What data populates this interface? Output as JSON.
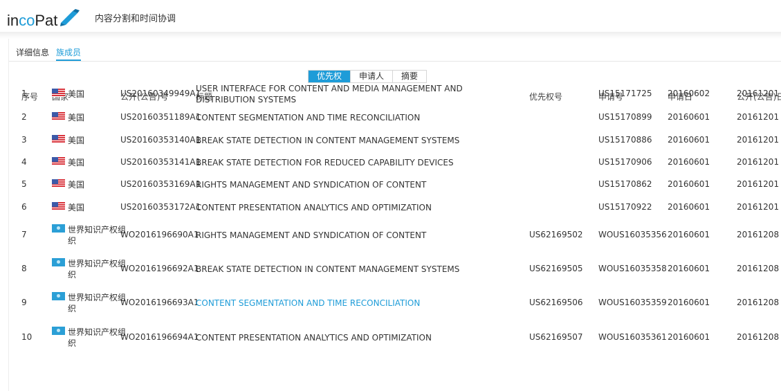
{
  "app": {
    "logo_prefix": "in",
    "logo_mid": "co",
    "logo_suffix": "Pat",
    "page_title": "内容分割和时间协调"
  },
  "tabs": [
    {
      "label": "详细信息",
      "active": false
    },
    {
      "label": "族成员",
      "active": true
    }
  ],
  "segmented": [
    {
      "label": "优先权",
      "active": true
    },
    {
      "label": "申请人",
      "active": false
    },
    {
      "label": "摘要",
      "active": false
    }
  ],
  "colors": {
    "accent": "#1e9cd8"
  },
  "table": {
    "headers": [
      "序号",
      "国家",
      "公开(公告)号",
      "标题",
      "优先权号",
      "申请号",
      "申请日",
      "公开(公告)日"
    ],
    "rows": [
      {
        "no": "1",
        "flag": "us-flag-icon",
        "country": "美国",
        "pub_no": "US20160349949A1",
        "title": "USER INTERFACE FOR CONTENT AND MEDIA MANAGEMENT AND DISTRIBUTION SYSTEMS",
        "priority_no": "",
        "app_no": "US15171725",
        "app_date": "20160602",
        "pub_date": "20161201",
        "link": false
      },
      {
        "no": "2",
        "flag": "us-flag-icon",
        "country": "美国",
        "pub_no": "US20160351189A1",
        "title": "CONTENT SEGMENTATION AND TIME RECONCILIATION",
        "priority_no": "",
        "app_no": "US15170899",
        "app_date": "20160601",
        "pub_date": "20161201",
        "link": false
      },
      {
        "no": "3",
        "flag": "us-flag-icon",
        "country": "美国",
        "pub_no": "US20160353140A1",
        "title": "BREAK STATE DETECTION IN CONTENT MANAGEMENT SYSTEMS",
        "priority_no": "",
        "app_no": "US15170886",
        "app_date": "20160601",
        "pub_date": "20161201",
        "link": false
      },
      {
        "no": "4",
        "flag": "us-flag-icon",
        "country": "美国",
        "pub_no": "US20160353141A1",
        "title": "BREAK STATE DETECTION FOR REDUCED CAPABILITY DEVICES",
        "priority_no": "",
        "app_no": "US15170906",
        "app_date": "20160601",
        "pub_date": "20161201",
        "link": false
      },
      {
        "no": "5",
        "flag": "us-flag-icon",
        "country": "美国",
        "pub_no": "US20160353169A1",
        "title": "RIGHTS MANAGEMENT AND SYNDICATION OF CONTENT",
        "priority_no": "",
        "app_no": "US15170862",
        "app_date": "20160601",
        "pub_date": "20161201",
        "link": false
      },
      {
        "no": "6",
        "flag": "us-flag-icon",
        "country": "美国",
        "pub_no": "US20160353172A1",
        "title": "CONTENT PRESENTATION ANALYTICS AND OPTIMIZATION",
        "priority_no": "",
        "app_no": "US15170922",
        "app_date": "20160601",
        "pub_date": "20161201",
        "link": false
      },
      {
        "no": "7",
        "flag": "wipo-flag-icon",
        "country": "世界知识产权组织",
        "pub_no": "WO2016196690A1",
        "title": "RIGHTS MANAGEMENT AND SYNDICATION OF CONTENT",
        "priority_no": "US62169502",
        "app_no": "WOUS16035356",
        "app_date": "20160601",
        "pub_date": "20161208",
        "link": false
      },
      {
        "no": "8",
        "flag": "wipo-flag-icon",
        "country": "世界知识产权组织",
        "pub_no": "WO2016196692A1",
        "title": "BREAK STATE DETECTION IN CONTENT MANAGEMENT SYSTEMS",
        "priority_no": "US62169505",
        "app_no": "WOUS16035358",
        "app_date": "20160601",
        "pub_date": "20161208",
        "link": false
      },
      {
        "no": "9",
        "flag": "wipo-flag-icon",
        "country": "世界知识产权组织",
        "pub_no": "WO2016196693A1",
        "title": "CONTENT SEGMENTATION AND TIME RECONCILIATION",
        "priority_no": "US62169506",
        "app_no": "WOUS16035359",
        "app_date": "20160601",
        "pub_date": "20161208",
        "link": true
      },
      {
        "no": "10",
        "flag": "wipo-flag-icon",
        "country": "世界知识产权组织",
        "pub_no": "WO2016196694A1",
        "title": "CONTENT PRESENTATION ANALYTICS AND OPTIMIZATION",
        "priority_no": "US62169507",
        "app_no": "WOUS16035361",
        "app_date": "20160601",
        "pub_date": "20161208",
        "link": false
      }
    ]
  }
}
